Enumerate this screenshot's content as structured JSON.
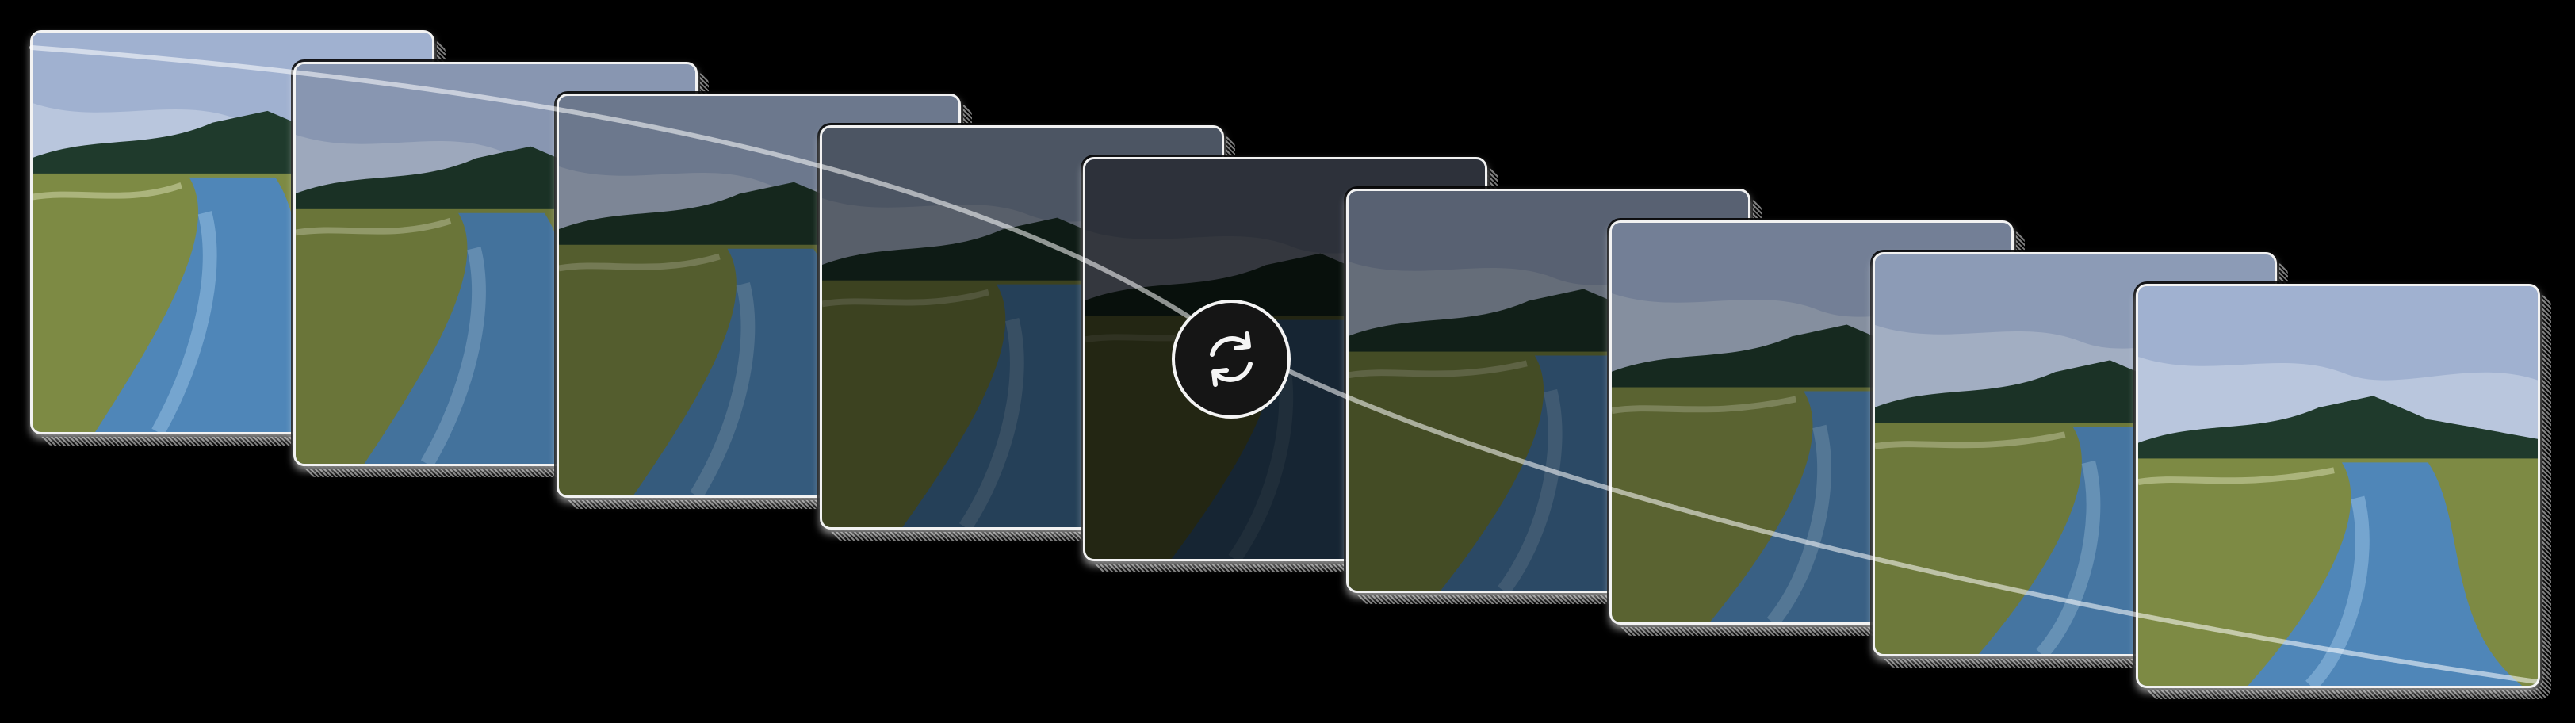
{
  "frames": [
    {
      "label": "frame-1",
      "darkness": 0.0
    },
    {
      "label": "frame-2",
      "darkness": 0.15
    },
    {
      "label": "frame-3",
      "darkness": 0.32
    },
    {
      "label": "frame-4",
      "darkness": 0.52
    },
    {
      "label": "frame-5",
      "darkness": 0.72
    },
    {
      "label": "frame-6",
      "darkness": 0.45
    },
    {
      "label": "frame-7",
      "darkness": 0.28
    },
    {
      "label": "frame-8",
      "darkness": 0.12
    },
    {
      "label": "frame-9",
      "darkness": 0.0
    }
  ],
  "center_control": {
    "icon": "refresh-cycle-icon"
  },
  "colors": {
    "background": "#000000",
    "frame_border": "#f2f2f2",
    "sky": "#b9c6dd",
    "water": "#4f86b8",
    "grass": "#7d8a44",
    "trees": "#1f3a2c"
  }
}
